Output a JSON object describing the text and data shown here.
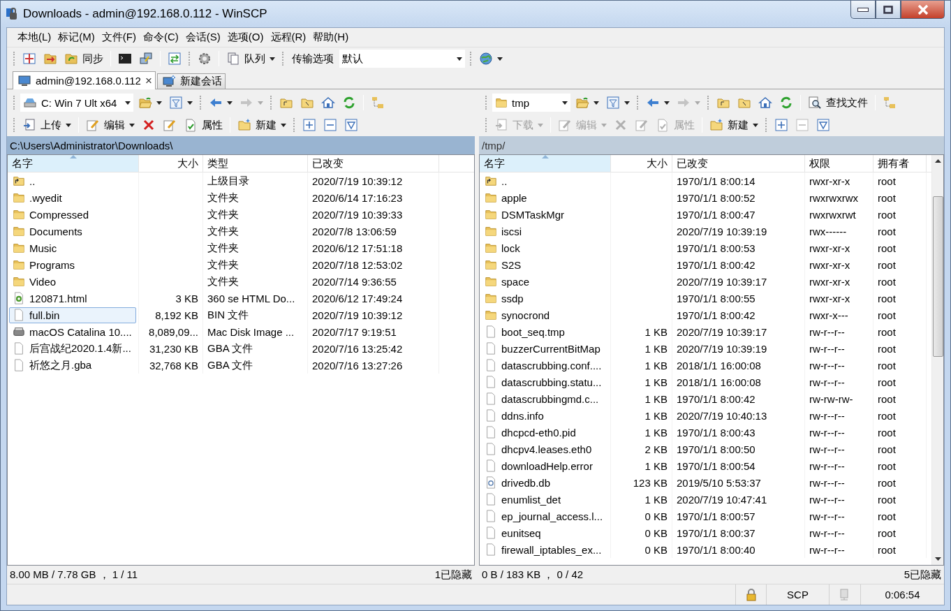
{
  "window": {
    "title": "Downloads - admin@192.168.0.112 - WinSCP"
  },
  "menu": [
    "本地(L)",
    "标记(M)",
    "文件(F)",
    "命令(C)",
    "会话(S)",
    "选项(O)",
    "远程(R)",
    "帮助(H)"
  ],
  "toolbar": {
    "sync": "同步",
    "queue": "队列",
    "transfer_label": "传输选项",
    "transfer_value": "默认"
  },
  "tabs": [
    {
      "label": "admin@192.168.0.112",
      "selected": true,
      "close": "×"
    },
    {
      "label": "新建会话",
      "selected": false
    }
  ],
  "panels": [
    {
      "location": "C: Win 7 Ult x64",
      "active": true,
      "actions": [
        {
          "label": "上传",
          "disabled": false
        },
        {
          "label": "编辑",
          "disabled": false
        },
        {
          "label": "属性",
          "disabled": false
        },
        {
          "label": "新建",
          "disabled": false
        }
      ],
      "path": "C:\\Users\\Administrator\\Downloads\\",
      "columns": [
        {
          "label": "名字",
          "sorted": true
        },
        {
          "label": "大小",
          "sorted": false
        },
        {
          "label": "类型",
          "sorted": false
        },
        {
          "label": "已改变",
          "sorted": false
        }
      ],
      "rows": [
        {
          "kind": "parent",
          "selected": false,
          "cells": [
            "..",
            "",
            "上级目录",
            "2020/7/19  10:39:12"
          ]
        },
        {
          "kind": "folder",
          "selected": false,
          "cells": [
            ".wyedit",
            "",
            "文件夹",
            "2020/6/14  17:16:23"
          ]
        },
        {
          "kind": "folder",
          "selected": false,
          "cells": [
            "Compressed",
            "",
            "文件夹",
            "2020/7/19  10:39:33"
          ]
        },
        {
          "kind": "folder",
          "selected": false,
          "cells": [
            "Documents",
            "",
            "文件夹",
            "2020/7/8  13:06:59"
          ]
        },
        {
          "kind": "folder",
          "selected": false,
          "cells": [
            "Music",
            "",
            "文件夹",
            "2020/6/12  17:51:18"
          ]
        },
        {
          "kind": "folder",
          "selected": false,
          "cells": [
            "Programs",
            "",
            "文件夹",
            "2020/7/18  12:53:02"
          ]
        },
        {
          "kind": "folder",
          "selected": false,
          "cells": [
            "Video",
            "",
            "文件夹",
            "2020/7/14  9:36:55"
          ]
        },
        {
          "kind": "html",
          "selected": false,
          "cells": [
            "120871.html",
            "3 KB",
            "360 se HTML Do...",
            "2020/6/12  17:49:24"
          ]
        },
        {
          "kind": "file",
          "selected": true,
          "cells": [
            "full.bin",
            "8,192 KB",
            "BIN 文件",
            "2020/7/19  10:39:12"
          ]
        },
        {
          "kind": "disk",
          "selected": false,
          "cells": [
            "macOS Catalina 10....",
            "8,089,09...",
            "Mac Disk Image ...",
            "2020/7/17  9:19:51"
          ]
        },
        {
          "kind": "file",
          "selected": false,
          "cells": [
            "后宫战纪2020.1.4新...",
            "31,230 KB",
            "GBA 文件",
            "2020/7/16  13:25:42"
          ]
        },
        {
          "kind": "file",
          "selected": false,
          "cells": [
            "祈悠之月.gba",
            "32,768 KB",
            "GBA 文件",
            "2020/7/16  13:27:26"
          ]
        }
      ],
      "status": "8.00 MB / 7.78 GB ， 1 / 11",
      "hidden": "1已隐藏"
    },
    {
      "location": "tmp",
      "active": false,
      "find": "查找文件",
      "actions": [
        {
          "label": "下载",
          "disabled": true
        },
        {
          "label": "编辑",
          "disabled": true
        },
        {
          "label": "属性",
          "disabled": true
        },
        {
          "label": "新建",
          "disabled": false
        }
      ],
      "path": "/tmp/",
      "columns": [
        {
          "label": "名字",
          "sorted": true
        },
        {
          "label": "大小",
          "sorted": false
        },
        {
          "label": "已改变",
          "sorted": false
        },
        {
          "label": "权限",
          "sorted": false
        },
        {
          "label": "拥有者",
          "sorted": false
        }
      ],
      "rows": [
        {
          "kind": "parent",
          "selected": false,
          "cells": [
            "..",
            "",
            "1970/1/1 8:00:14",
            "rwxr-xr-x",
            "root"
          ]
        },
        {
          "kind": "folder",
          "selected": false,
          "cells": [
            "apple",
            "",
            "1970/1/1 8:00:52",
            "rwxrwxrwx",
            "root"
          ]
        },
        {
          "kind": "folder",
          "selected": false,
          "cells": [
            "DSMTaskMgr",
            "",
            "1970/1/1 8:00:47",
            "rwxrwxrwt",
            "root"
          ]
        },
        {
          "kind": "folder",
          "selected": false,
          "cells": [
            "iscsi",
            "",
            "2020/7/19 10:39:19",
            "rwx------",
            "root"
          ]
        },
        {
          "kind": "folder",
          "selected": false,
          "cells": [
            "lock",
            "",
            "1970/1/1 8:00:53",
            "rwxr-xr-x",
            "root"
          ]
        },
        {
          "kind": "folder",
          "selected": false,
          "cells": [
            "S2S",
            "",
            "1970/1/1 8:00:42",
            "rwxr-xr-x",
            "root"
          ]
        },
        {
          "kind": "folder",
          "selected": false,
          "cells": [
            "space",
            "",
            "2020/7/19 10:39:17",
            "rwxr-xr-x",
            "root"
          ]
        },
        {
          "kind": "folder",
          "selected": false,
          "cells": [
            "ssdp",
            "",
            "1970/1/1 8:00:55",
            "rwxr-xr-x",
            "root"
          ]
        },
        {
          "kind": "folder",
          "selected": false,
          "cells": [
            "synocrond",
            "",
            "1970/1/1 8:00:42",
            "rwxr-x---",
            "root"
          ]
        },
        {
          "kind": "file",
          "selected": false,
          "cells": [
            "boot_seq.tmp",
            "1 KB",
            "2020/7/19 10:39:17",
            "rw-r--r--",
            "root"
          ]
        },
        {
          "kind": "file",
          "selected": false,
          "cells": [
            "buzzerCurrentBitMap",
            "1 KB",
            "2020/7/19 10:39:19",
            "rw-r--r--",
            "root"
          ]
        },
        {
          "kind": "file",
          "selected": false,
          "cells": [
            "datascrubbing.conf....",
            "1 KB",
            "2018/1/1 16:00:08",
            "rw-r--r--",
            "root"
          ]
        },
        {
          "kind": "file",
          "selected": false,
          "cells": [
            "datascrubbing.statu...",
            "1 KB",
            "2018/1/1 16:00:08",
            "rw-r--r--",
            "root"
          ]
        },
        {
          "kind": "file",
          "selected": false,
          "cells": [
            "datascrubbingmd.c...",
            "1 KB",
            "1970/1/1 8:00:42",
            "rw-rw-rw-",
            "root"
          ]
        },
        {
          "kind": "file",
          "selected": false,
          "cells": [
            "ddns.info",
            "1 KB",
            "2020/7/19 10:40:13",
            "rw-r--r--",
            "root"
          ]
        },
        {
          "kind": "file",
          "selected": false,
          "cells": [
            "dhcpcd-eth0.pid",
            "1 KB",
            "1970/1/1 8:00:43",
            "rw-r--r--",
            "root"
          ]
        },
        {
          "kind": "file",
          "selected": false,
          "cells": [
            "dhcpv4.leases.eth0",
            "2 KB",
            "1970/1/1 8:00:50",
            "rw-r--r--",
            "root"
          ]
        },
        {
          "kind": "file",
          "selected": false,
          "cells": [
            "downloadHelp.error",
            "1 KB",
            "1970/1/1 8:00:54",
            "rw-r--r--",
            "root"
          ]
        },
        {
          "kind": "db",
          "selected": false,
          "cells": [
            "drivedb.db",
            "123 KB",
            "2019/5/10 5:53:37",
            "rw-r--r--",
            "root"
          ]
        },
        {
          "kind": "file",
          "selected": false,
          "cells": [
            "enumlist_det",
            "1 KB",
            "2020/7/19 10:47:41",
            "rw-r--r--",
            "root"
          ]
        },
        {
          "kind": "file",
          "selected": false,
          "cells": [
            "ep_journal_access.l...",
            "0 KB",
            "1970/1/1 8:00:57",
            "rw-r--r--",
            "root"
          ]
        },
        {
          "kind": "file",
          "selected": false,
          "cells": [
            "eunitseq",
            "0 KB",
            "1970/1/1 8:00:37",
            "rw-r--r--",
            "root"
          ]
        },
        {
          "kind": "file",
          "selected": false,
          "cells": [
            "firewall_iptables_ex...",
            "0 KB",
            "1970/1/1 8:00:40",
            "rw-r--r--",
            "root"
          ]
        }
      ],
      "status": "0 B / 183 KB ， 0 / 42",
      "hidden": "5已隐藏"
    }
  ],
  "status_bar": {
    "protocol": "SCP",
    "elapsed": "0:06:54"
  }
}
